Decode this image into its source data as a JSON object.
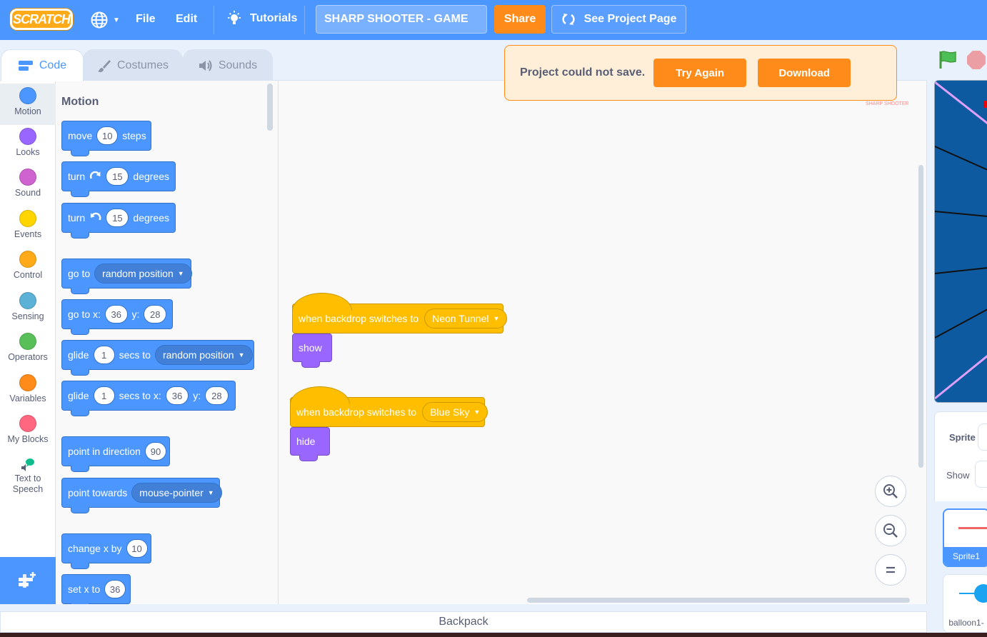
{
  "menubar": {
    "logo_text": "SCRATCH",
    "file": "File",
    "edit": "Edit",
    "tutorials": "Tutorials",
    "project_title": "SHARP SHOOTER - GAME",
    "share": "Share",
    "see_project_page": "See Project Page"
  },
  "tabs": [
    {
      "label": "Code",
      "icon": "code-icon"
    },
    {
      "label": "Costumes",
      "icon": "brush-icon"
    },
    {
      "label": "Sounds",
      "icon": "speaker-icon"
    }
  ],
  "categories": [
    {
      "label": "Motion",
      "color": "#4c97ff"
    },
    {
      "label": "Looks",
      "color": "#9966ff"
    },
    {
      "label": "Sound",
      "color": "#cf63cf"
    },
    {
      "label": "Events",
      "color": "#ffd500"
    },
    {
      "label": "Control",
      "color": "#ffab19"
    },
    {
      "label": "Sensing",
      "color": "#5cb1d6"
    },
    {
      "label": "Operators",
      "color": "#59c059"
    },
    {
      "label": "Variables",
      "color": "#ff8c1a"
    },
    {
      "label": "My Blocks",
      "color": "#ff6680"
    },
    {
      "label": "Text to Speech",
      "color": "#0fbd8c"
    }
  ],
  "palette": {
    "title": "Motion",
    "blocks": {
      "move": {
        "a": "move",
        "v": "10",
        "b": "steps"
      },
      "turn_right": {
        "a": "turn",
        "v": "15",
        "b": "degrees"
      },
      "turn_left": {
        "a": "turn",
        "v": "15",
        "b": "degrees"
      },
      "goto": {
        "a": "go to",
        "opt": "random position"
      },
      "goto_xy": {
        "a": "go to x:",
        "x": "36",
        "b": "y:",
        "y": "28"
      },
      "glide": {
        "a": "glide",
        "v": "1",
        "b": "secs to",
        "opt": "random position"
      },
      "glide_xy": {
        "a": "glide",
        "v": "1",
        "b": "secs to x:",
        "x": "36",
        "c": "y:",
        "y": "28"
      },
      "point_dir": {
        "a": "point in direction",
        "v": "90"
      },
      "point_towards": {
        "a": "point towards",
        "opt": "mouse-pointer"
      },
      "change_x": {
        "a": "change x by",
        "v": "10"
      },
      "set_x": {
        "a": "set x to",
        "v": "36"
      }
    }
  },
  "workspace": {
    "script1": {
      "hat": "when backdrop switches to",
      "backdrop": "Neon Tunnel",
      "action": "show"
    },
    "script2": {
      "hat": "when backdrop switches to",
      "backdrop": "Blue Sky",
      "action": "hide"
    },
    "watermark": "SHARP SHOOTER"
  },
  "alert": {
    "message": "Project could not save.",
    "try_again": "Try Again",
    "download": "Download"
  },
  "sprite_pane": {
    "sprite_label": "Sprite",
    "show_label": "Show",
    "sprites": [
      {
        "name": "Sprite1"
      },
      {
        "name": "balloon1-"
      }
    ]
  },
  "backpack": "Backpack"
}
